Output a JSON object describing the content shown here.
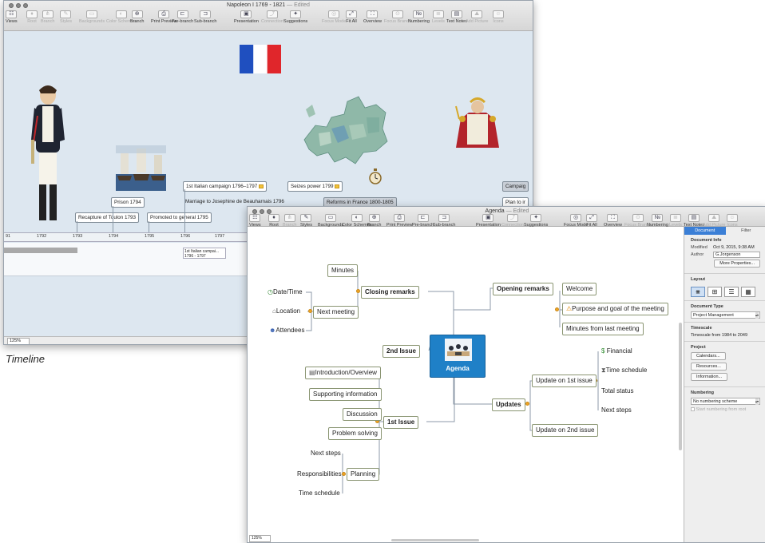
{
  "timeline_window": {
    "title": "Napoleon I 1769 - 1821",
    "edited": "— Edited",
    "toolbar": [
      {
        "label": "Views",
        "icon": "views-icon",
        "glyph": "☷"
      },
      {
        "label": "Root",
        "icon": "root-icon",
        "glyph": "♦"
      },
      {
        "label": "Branch",
        "icon": "branch-icon",
        "glyph": "⋔"
      },
      {
        "label": "Styles",
        "icon": "styles-icon",
        "glyph": "✎"
      },
      {
        "label": "Backgrounds",
        "icon": "backgrounds-icon",
        "glyph": "▭"
      },
      {
        "label": "Color Schemes",
        "icon": "color-schemes-icon",
        "glyph": "◐"
      },
      {
        "label": "Branch",
        "icon": "branch-icon",
        "glyph": "⊕"
      },
      {
        "label": "Print Preview",
        "icon": "print-preview-icon",
        "glyph": "⎙"
      },
      {
        "label": "Pre-branch",
        "icon": "pre-branch-icon",
        "glyph": "⊏"
      },
      {
        "label": "Sub-branch",
        "icon": "sub-branch-icon",
        "glyph": "⊐"
      },
      {
        "label": "Presentation",
        "icon": "presentation-icon",
        "glyph": "▣"
      },
      {
        "label": "Connection",
        "icon": "connection-icon",
        "glyph": "⤴"
      },
      {
        "label": "Suggestions",
        "icon": "suggestions-icon",
        "glyph": "✦"
      },
      {
        "label": "Focus Mode",
        "icon": "focus-mode-icon",
        "glyph": "◎"
      },
      {
        "label": "Fit All",
        "icon": "fit-all-icon",
        "glyph": "⤢"
      },
      {
        "label": "Overview",
        "icon": "overview-icon",
        "glyph": "⛶"
      },
      {
        "label": "Focus Branch",
        "icon": "focus-branch-icon",
        "glyph": "⊙"
      },
      {
        "label": "Numbering",
        "icon": "numbering-icon",
        "glyph": "№"
      },
      {
        "label": "Levels",
        "icon": "levels-icon",
        "glyph": "≣"
      },
      {
        "label": "Text Notes",
        "icon": "text-notes-icon",
        "glyph": "▤"
      },
      {
        "label": "Add Picture",
        "icon": "add-picture-icon",
        "glyph": "⛰"
      },
      {
        "label": "Icons",
        "icon": "icons-icon",
        "glyph": "☺"
      }
    ],
    "nodes": [
      {
        "label": "1st Italian campaign 1796–1797"
      },
      {
        "label": "Marriage to Josephine de Beauharnais 1796"
      },
      {
        "label": "Seizes power 1799"
      },
      {
        "label": "Reforms in France 1800-1805"
      },
      {
        "label": "Prison 1794"
      },
      {
        "label": "Recapture of Toulon 1793"
      },
      {
        "label": "Promoted to general 1795"
      },
      {
        "label": "Campaig"
      },
      {
        "label": "Plan to ir"
      }
    ],
    "ruler_years": [
      "91",
      "1792",
      "1793",
      "1794",
      "1795",
      "1796",
      "1797"
    ],
    "bar_label_1": "1st Italian campai...",
    "bar_label_2": "1796 - 1797",
    "zoom": "125%",
    "flag_colors": [
      "#1f4fbf",
      "#ffffff",
      "#e0262b"
    ]
  },
  "caption": "Timeline",
  "agenda_window": {
    "title": "Agenda",
    "edited": "— Edited",
    "toolbar": [
      {
        "label": "Views",
        "icon": "views-icon",
        "glyph": "☷"
      },
      {
        "label": "Root",
        "icon": "root-icon",
        "glyph": "♦"
      },
      {
        "label": "Branch",
        "icon": "branch-icon",
        "glyph": "⋔"
      },
      {
        "label": "Styles",
        "icon": "styles-icon",
        "glyph": "✎"
      },
      {
        "label": "Backgrounds",
        "icon": "backgrounds-icon",
        "glyph": "▭"
      },
      {
        "label": "Color Schemes",
        "icon": "color-schemes-icon",
        "glyph": "◐"
      },
      {
        "label": "Branch",
        "icon": "branch-icon",
        "glyph": "⊕"
      },
      {
        "label": "Print Preview",
        "icon": "print-preview-icon",
        "glyph": "⎙"
      },
      {
        "label": "Pre-branch",
        "icon": "pre-branch-icon",
        "glyph": "⊏"
      },
      {
        "label": "Sub-branch",
        "icon": "sub-branch-icon",
        "glyph": "⊐"
      },
      {
        "label": "Presentation",
        "icon": "presentation-icon",
        "glyph": "▣"
      },
      {
        "label": "Connection",
        "icon": "connection-icon",
        "glyph": "⤴"
      },
      {
        "label": "Suggestions",
        "icon": "suggestions-icon",
        "glyph": "✦"
      },
      {
        "label": "Focus Mode",
        "icon": "focus-mode-icon",
        "glyph": "◎"
      },
      {
        "label": "Fit All",
        "icon": "fit-all-icon",
        "glyph": "⤢"
      },
      {
        "label": "Overview",
        "icon": "overview-icon",
        "glyph": "⛶"
      },
      {
        "label": "Focus Branch",
        "icon": "focus-branch-icon",
        "glyph": "⊙"
      },
      {
        "label": "Numbering",
        "icon": "numbering-icon",
        "glyph": "№"
      },
      {
        "label": "Levels",
        "icon": "levels-icon",
        "glyph": "≣"
      },
      {
        "label": "Text Notes",
        "icon": "text-notes-icon",
        "glyph": "▤"
      },
      {
        "label": "Add Picture",
        "icon": "add-picture-icon",
        "glyph": "⛰"
      },
      {
        "label": "Icons",
        "icon": "icons-icon",
        "glyph": "☺"
      }
    ],
    "central": "Agenda",
    "main_branches": {
      "closing": "Closing remarks",
      "opening": "Opening remarks",
      "second": "2nd Issue",
      "first": "1st Issue",
      "updates": "Updates"
    },
    "closing_children": {
      "minutes": "Minutes",
      "next_meeting": "Next meeting",
      "date_time": "Date/Time",
      "location": "Location",
      "attendees": "Attendees"
    },
    "opening_children": {
      "welcome": "Welcome",
      "purpose": "Purpose and goal of the meeting",
      "minutes_last": "Minutes from last meeting"
    },
    "updates_children": {
      "update1": "Update on 1st issue",
      "update2": "Update on 2nd issue",
      "financial": "Financial",
      "time_schedule": "Time schedule",
      "total_status": "Total status",
      "next_steps": "Next steps"
    },
    "first_children": {
      "intro": "Introduction/Overview",
      "supporting": "Supporting information",
      "discussion": "Discussion",
      "problem": "Problem solving",
      "planning": "Planning",
      "next_steps": "Next steps",
      "responsibilities": "Responsibilities",
      "time_schedule": "Time schedule"
    },
    "zoom": "125%"
  },
  "inspector": {
    "tabs": [
      "Document",
      "Filter"
    ],
    "doc_info_title": "Document Info",
    "modified_label": "Modified",
    "modified_value": "Oct 9, 2015, 9:38 AM",
    "author_label": "Author",
    "author_value": "G.Jorgenson",
    "more_properties": "More Properties...",
    "layout_title": "Layout",
    "doc_type_title": "Document Type",
    "doc_type_value": "Project Management",
    "timescale_title": "Timescale",
    "timescale_value": "Timescale from 1984 to 2049",
    "project_title": "Project",
    "calendars": "Calendars...",
    "resources": "Resources...",
    "information": "Information...",
    "numbering_title": "Numbering",
    "numbering_value": "No numbering scheme",
    "start_numbering": "Start numbering from root"
  }
}
